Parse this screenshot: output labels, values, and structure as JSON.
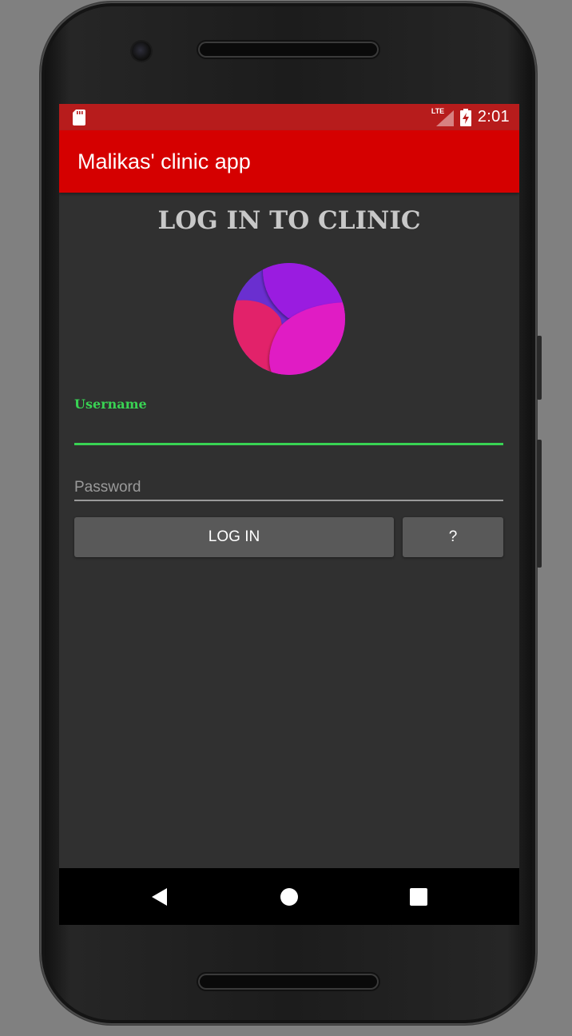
{
  "status_bar": {
    "time": "2:01",
    "network": "LTE",
    "icons": [
      "sd-card-icon",
      "lte-signal-icon",
      "battery-charging-icon"
    ]
  },
  "app_bar": {
    "title": "Malikas' clinic app"
  },
  "login": {
    "heading": "LOG IN TO CLINIC",
    "username_label": "Username",
    "username_value": "",
    "password_placeholder": "Password",
    "password_value": "",
    "login_button": "LOG IN",
    "help_button": "?"
  },
  "nav_bar": {
    "icons": [
      "back-icon",
      "home-icon",
      "recents-icon"
    ]
  },
  "colors": {
    "status_bar": "#b71c1c",
    "app_bar": "#d50000",
    "background": "#303030",
    "accent": "#39d353",
    "button": "#595959"
  }
}
